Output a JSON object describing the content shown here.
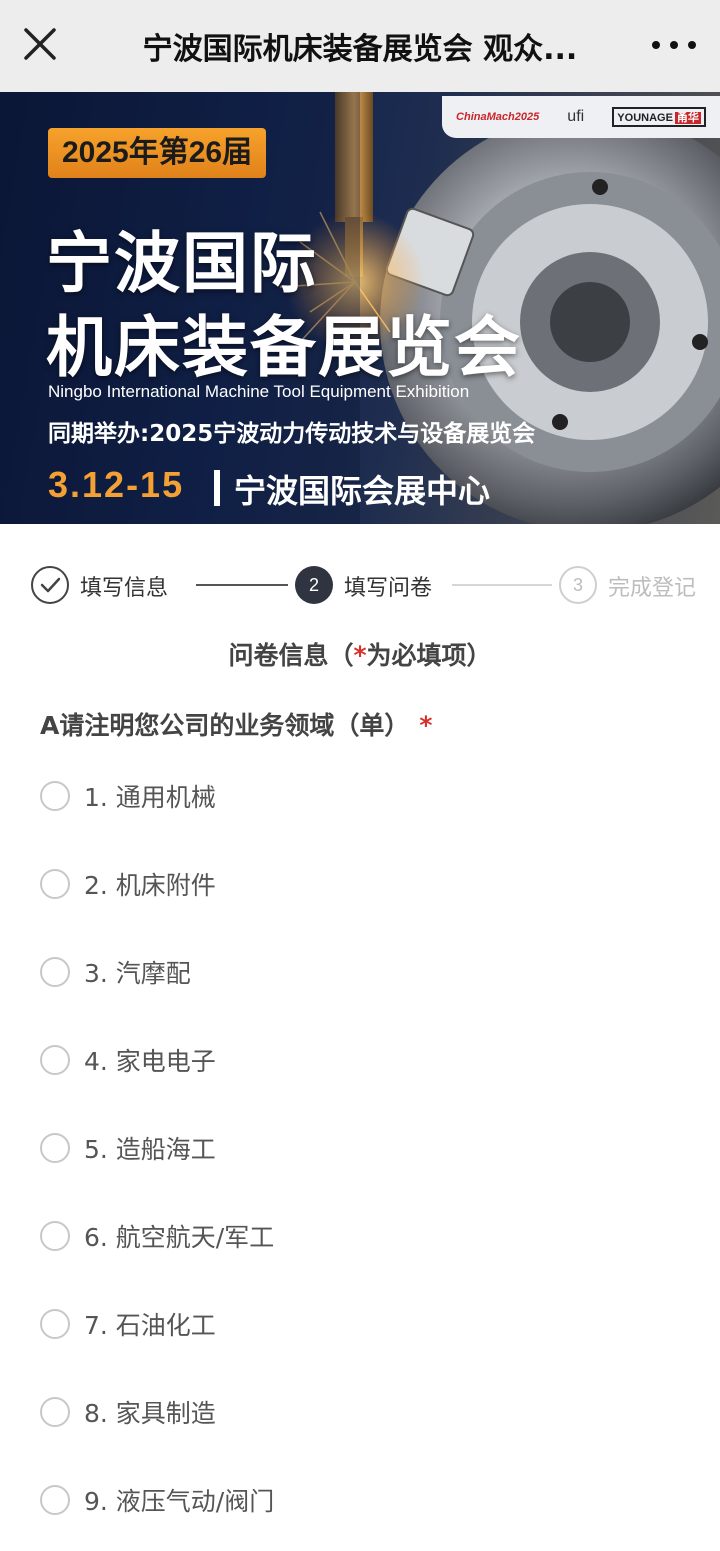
{
  "header": {
    "title": "宁波国际机床装备展览会 观众...",
    "close_icon": "close-icon",
    "more_icon": "more-dots-icon"
  },
  "banner": {
    "year_badge": "2025年第26届",
    "title_line1": "宁波国际",
    "title_line2": "机床装备展览会",
    "english_title": "Ningbo International Machine Tool Equipment Exhibition",
    "concurrent": "同期举办:2025宁波动力传动技术与设备展览会",
    "dates": "3.12-15",
    "venue": "宁波国际会展中心",
    "logos": {
      "chinamach": "ChinaMach2025",
      "ufi": "ufi",
      "younage": "YOUNAGE",
      "younage_cn": "甬华"
    },
    "colors": {
      "accent": "#f4a034",
      "background": "#13244e"
    }
  },
  "steps": [
    {
      "label": "填写信息",
      "status": "done",
      "marker": ""
    },
    {
      "label": "填写问卷",
      "status": "current",
      "marker": "2"
    },
    {
      "label": "完成登记",
      "status": "pending",
      "marker": "3"
    }
  ],
  "form": {
    "section_title_before": "问卷信息（",
    "section_title_star": "*",
    "section_title_after": "为必填项）",
    "question": "A请注明您公司的业务领域（单）",
    "required_mark": "*",
    "options": [
      "1. 通用机械",
      "2. 机床附件",
      "3. 汽摩配",
      "4. 家电电子",
      "5. 造船海工",
      "6. 航空航天/军工",
      "7. 石油化工",
      "8. 家具制造",
      "9. 液压气动/阀门"
    ]
  }
}
